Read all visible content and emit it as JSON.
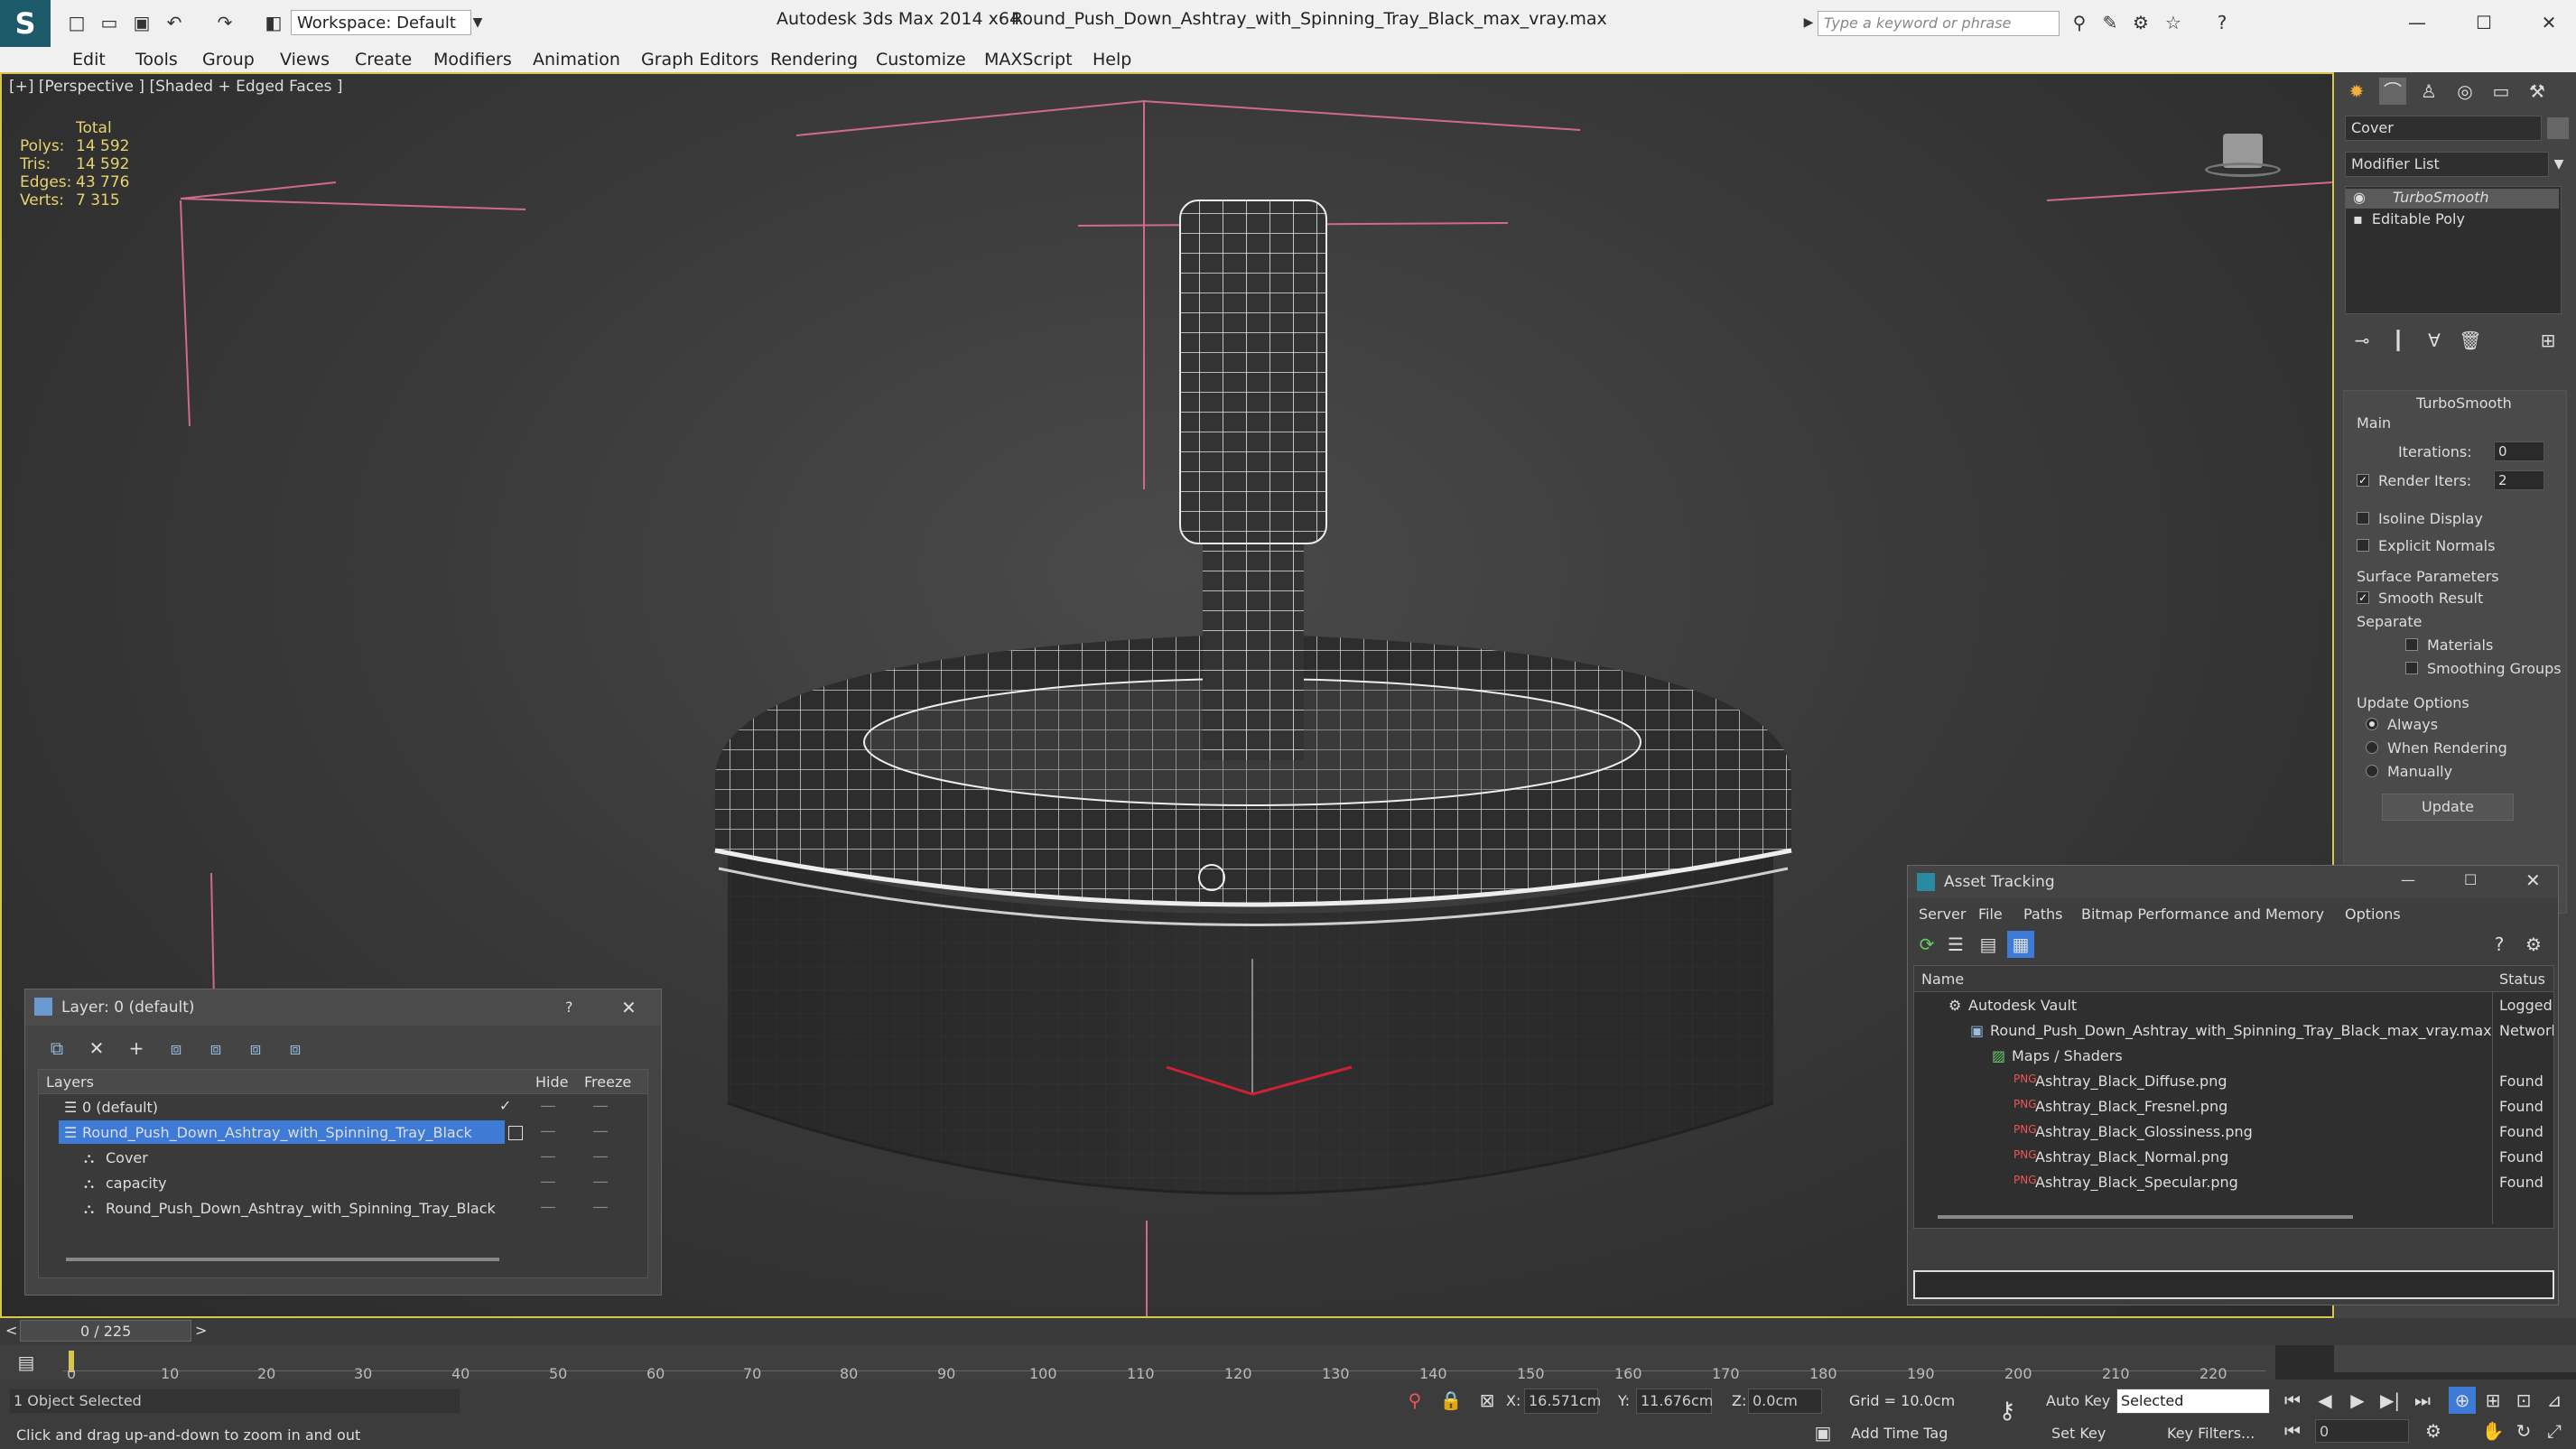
{
  "titlebar": {
    "app": "Autodesk 3ds Max  2014 x64",
    "file": "Round_Push_Down_Ashtray_with_Spinning_Tray_Black_max_vray.max",
    "workspace": "Workspace: Default",
    "search_placeholder": "Type a keyword or phrase"
  },
  "menu": [
    "Edit",
    "Tools",
    "Group",
    "Views",
    "Create",
    "Modifiers",
    "Animation",
    "Graph Editors",
    "Rendering",
    "Customize",
    "MAXScript",
    "Help"
  ],
  "viewport": {
    "label": "[+] [Perspective ] [Shaded + Edged Faces ]",
    "stats": {
      "total_label": "Total",
      "polys_label": "Polys:",
      "polys": "14 592",
      "tris_label": "Tris:",
      "tris": "14 592",
      "edges_label": "Edges:",
      "edges": "43 776",
      "verts_label": "Verts:",
      "verts": "7 315"
    }
  },
  "command_panel": {
    "object_name": "Cover",
    "modifier_list": "Modifier List",
    "stack": [
      "TurboSmooth",
      "Editable Poly"
    ],
    "rollout_title": "TurboSmooth",
    "main_label": "Main",
    "iterations_label": "Iterations:",
    "iterations": "0",
    "render_iters_label": "Render Iters:",
    "render_iters": "2",
    "isoline": "Isoline Display",
    "explicit_normals": "Explicit Normals",
    "surface_params": "Surface Parameters",
    "smooth_result": "Smooth Result",
    "separate": "Separate",
    "materials": "Materials",
    "smoothing_groups": "Smoothing Groups",
    "update_options": "Update Options",
    "always": "Always",
    "when_rendering": "When Rendering",
    "manually": "Manually",
    "update_button": "Update"
  },
  "layer_dialog": {
    "title": "Layer: 0 (default)",
    "help": "?",
    "col_layers": "Layers",
    "col_hide": "Hide",
    "col_freeze": "Freeze",
    "rows": [
      {
        "name": "0 (default)"
      },
      {
        "name": "Round_Push_Down_Ashtray_with_Spinning_Tray_Black"
      },
      {
        "name": "Cover"
      },
      {
        "name": "capacity"
      },
      {
        "name": "Round_Push_Down_Ashtray_with_Spinning_Tray_Black"
      }
    ]
  },
  "asset_tracking": {
    "title": "Asset Tracking",
    "menu": [
      "Server",
      "File",
      "Paths",
      "Bitmap Performance and Memory",
      "Options"
    ],
    "col_name": "Name",
    "col_status": "Status",
    "rows": [
      {
        "name": "Autodesk Vault",
        "status": "Logged"
      },
      {
        "name": "Round_Push_Down_Ashtray_with_Spinning_Tray_Black_max_vray.max",
        "status": "Network"
      },
      {
        "name": "Maps / Shaders",
        "status": ""
      },
      {
        "name": "Ashtray_Black_Diffuse.png",
        "status": "Found"
      },
      {
        "name": "Ashtray_Black_Fresnel.png",
        "status": "Found"
      },
      {
        "name": "Ashtray_Black_Glossiness.png",
        "status": "Found"
      },
      {
        "name": "Ashtray_Black_Normal.png",
        "status": "Found"
      },
      {
        "name": "Ashtray_Black_Specular.png",
        "status": "Found"
      }
    ]
  },
  "timeline": {
    "frame": "0 / 225",
    "ticks": [
      "0",
      "10",
      "20",
      "30",
      "40",
      "50",
      "60",
      "70",
      "80",
      "90",
      "100",
      "110",
      "120",
      "130",
      "140",
      "150",
      "160",
      "170",
      "180",
      "190",
      "200",
      "210",
      "220"
    ]
  },
  "status": {
    "selected": "1 Object Selected",
    "hint": "Click and drag up-and-down to zoom in and out",
    "x_label": "X:",
    "x": "16.571cm",
    "y_label": "Y:",
    "y": "11.676cm",
    "z_label": "Z:",
    "z": "0.0cm",
    "grid": "Grid = 10.0cm",
    "auto_key": "Auto Key",
    "set_key": "Set Key",
    "selected_dropdown": "Selected",
    "key_filters": "Key Filters...",
    "add_time_tag": "Add Time Tag",
    "frame_field": "0"
  }
}
